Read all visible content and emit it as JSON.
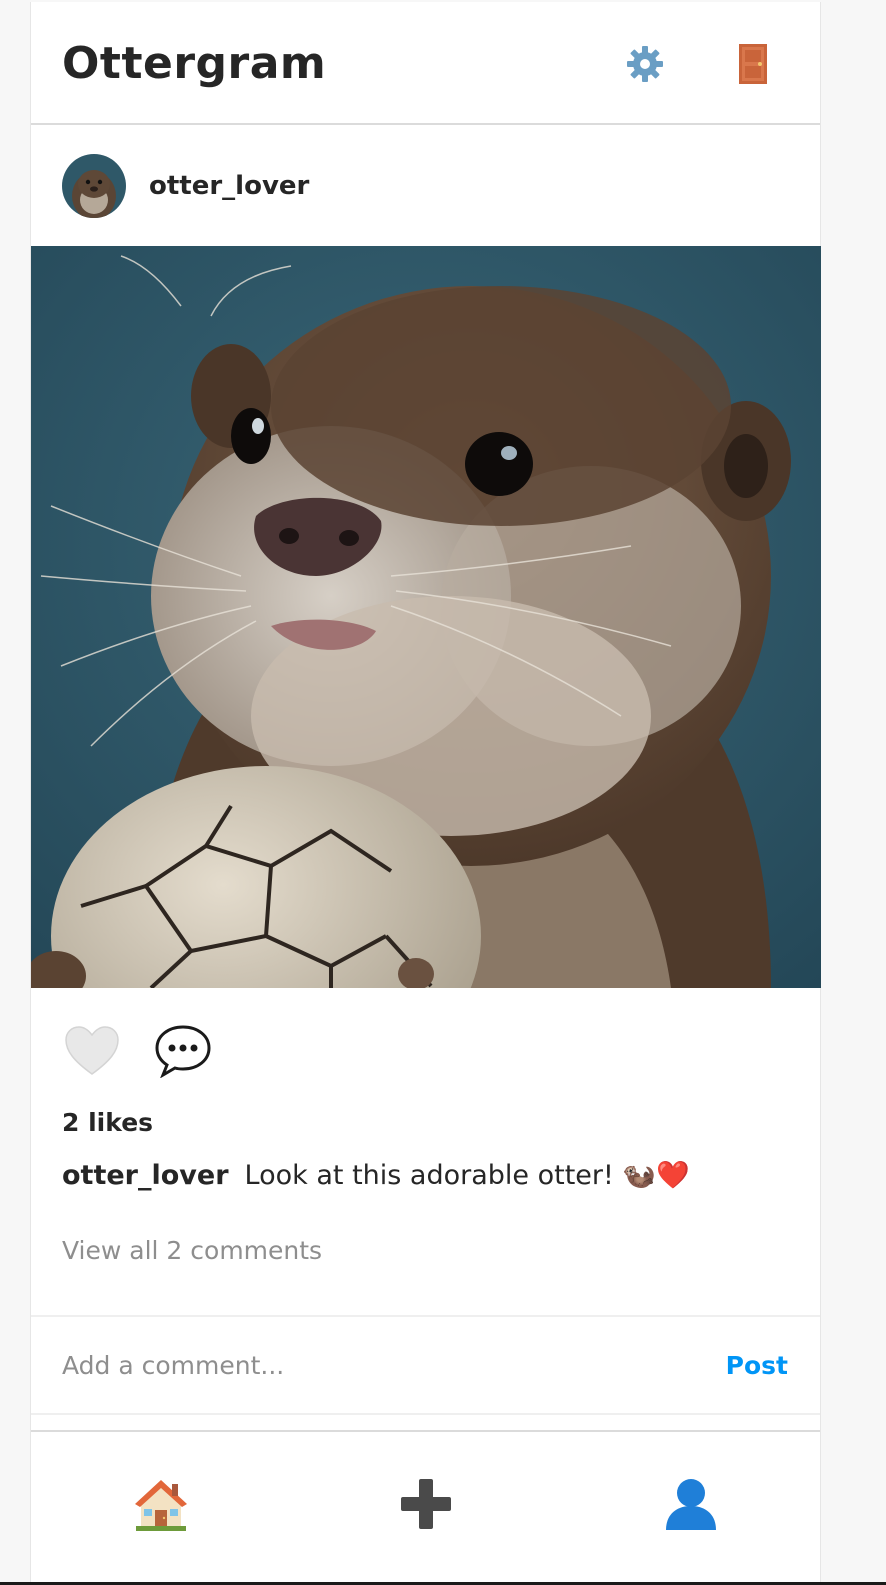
{
  "app": {
    "brand": "Ottergram"
  },
  "header": {
    "settings_icon": "gear-icon",
    "logout_icon": "door-icon"
  },
  "post": {
    "username": "otter_lover",
    "likes_text": "2 likes",
    "caption_user": "otter_lover",
    "caption_text": "Look at this adorable otter! 🦦❤️",
    "view_comments": "View all 2 comments",
    "liked": false
  },
  "comment_box": {
    "placeholder": "Add a comment...",
    "value": "",
    "post_label": "Post"
  },
  "bottom_nav": {
    "items": [
      {
        "icon": "home-icon"
      },
      {
        "icon": "plus-icon"
      },
      {
        "icon": "profile-icon"
      }
    ]
  },
  "colors": {
    "accent": "#0095f6",
    "muted": "#8e8e8e",
    "text": "#262626",
    "image_background": "#2d5566"
  }
}
